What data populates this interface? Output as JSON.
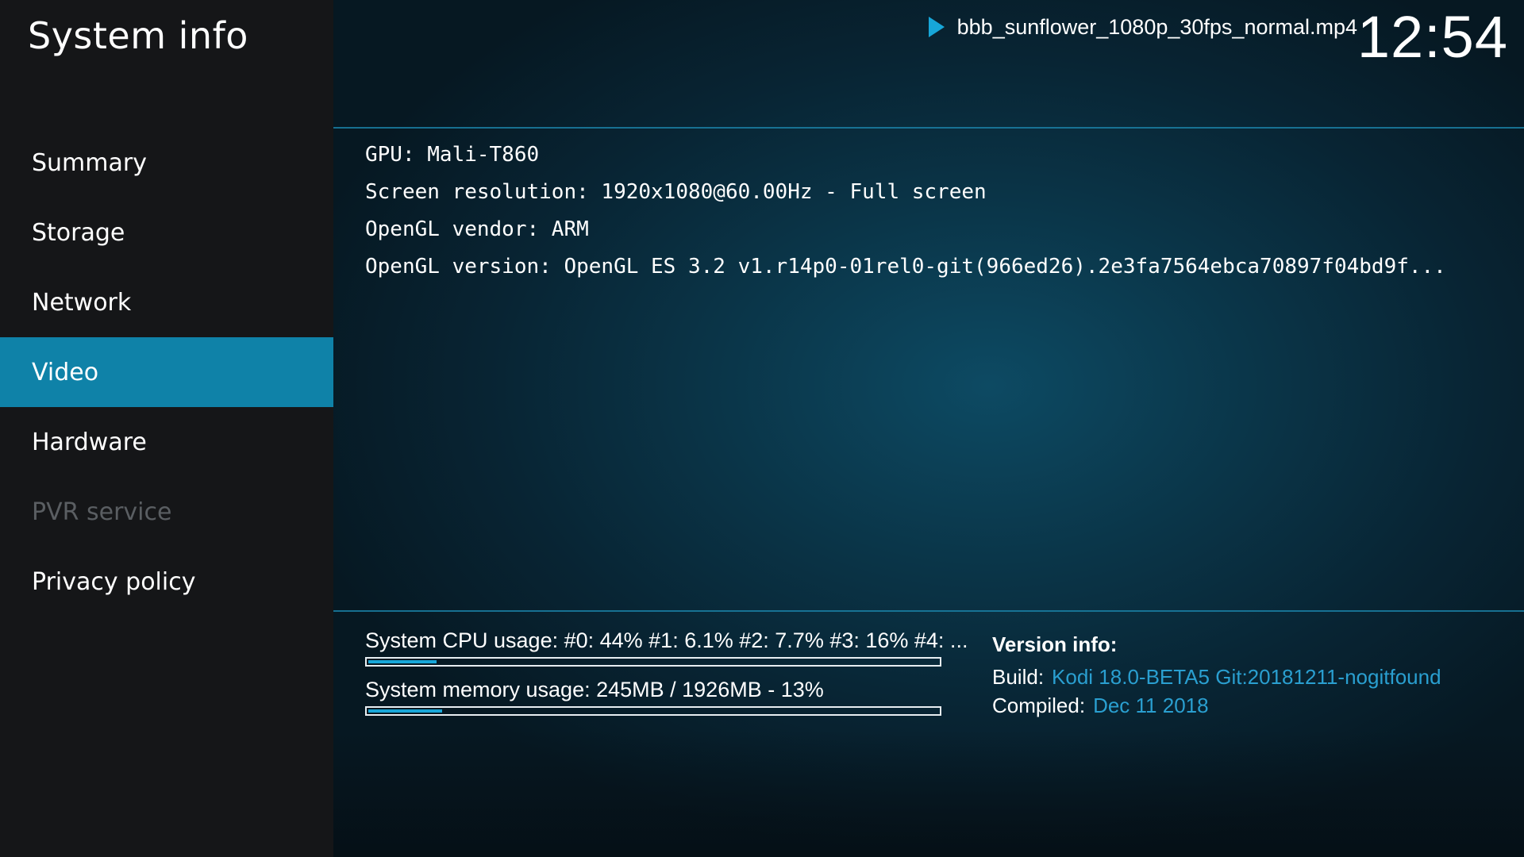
{
  "app": {
    "title": "System info"
  },
  "sidebar": {
    "items": [
      {
        "label": "Summary",
        "state": "normal"
      },
      {
        "label": "Storage",
        "state": "normal"
      },
      {
        "label": "Network",
        "state": "normal"
      },
      {
        "label": "Video",
        "state": "selected"
      },
      {
        "label": "Hardware",
        "state": "normal"
      },
      {
        "label": "PVR service",
        "state": "disabled"
      },
      {
        "label": "Privacy policy",
        "state": "normal"
      }
    ]
  },
  "header": {
    "now_playing_icon": "play-icon",
    "now_playing": "bbb_sunflower_1080p_30fps_normal.mp4",
    "clock": "12:54"
  },
  "info": {
    "lines": [
      "GPU: Mali-T860",
      "Screen resolution: 1920x1080@60.00Hz - Full screen",
      "OpenGL vendor: ARM",
      "OpenGL version: OpenGL ES 3.2 v1.r14p0-01rel0-git(966ed26).2e3fa7564ebca70897f04bd9f..."
    ]
  },
  "usage": {
    "cpu_label": "System CPU usage: #0:  44% #1: 6.1% #2: 7.7% #3:  16% #4: ...",
    "cpu_fraction": 0.12,
    "memory_label": "System memory usage: 245MB / 1926MB - 13%",
    "memory_fraction": 0.13
  },
  "version": {
    "title": "Version info:",
    "build_key": "Build:",
    "build_value": "Kodi 18.0-BETA5 Git:20181211-nogitfound",
    "compiled_key": "Compiled:",
    "compiled_value": "Dec 11 2018"
  },
  "colors": {
    "accent": "#17a6d8",
    "selected_bg": "#0f82a8",
    "sidebar_bg": "#151618",
    "disabled_text": "#5a5e62",
    "link_text": "#2a9fd0"
  }
}
